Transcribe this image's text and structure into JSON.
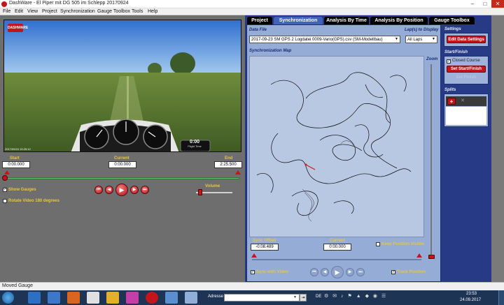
{
  "window": {
    "title": "DashWare - El Piper mit DG 505 im Schlepp 20170924",
    "min": "–",
    "max": "□",
    "close": "✕"
  },
  "menu": [
    "File",
    "Edit",
    "View",
    "Project",
    "Synchronization",
    "Gauge Toolbox",
    "Tools",
    "Help"
  ],
  "video": {
    "logo": "DASHWARE",
    "flight_time_value": "0:00",
    "flight_time_label": "Flight Time",
    "timestamp": "2017/09/24 15:25:12"
  },
  "timeline": {
    "start_label": "Start",
    "start_value": "0:00.000",
    "current_label": "Current",
    "current_value": "0:00.000",
    "end_label": "End",
    "end_value": "2:25.500"
  },
  "playback": {
    "show_gauges_label": "Show Gauges",
    "show_gauges_checked": true,
    "rotate_label": "Rotate Video 180 degrees",
    "rotate_checked": false,
    "volume_label": "Volume",
    "volume_level": 0.12
  },
  "tabs": [
    "Project",
    "Synchronization",
    "Analysis By Time",
    "Analysis By Position",
    "Gauge Toolbox"
  ],
  "active_tab": 1,
  "sync": {
    "data_file_label": "Data File",
    "data_file_value": "2017-09-23 SM GPS 2 Logdatei 0009-Vario(GPS).csv (SM-Modellbau)",
    "laps_label": "Lap(s) to Display",
    "laps_value": "All Laps",
    "map_label": "Synchronization Map",
    "zoom_label": "Zoom",
    "sync_offset_label": "Sync Offset",
    "sync_offset_value": "-0:08.489",
    "current_label": "Current",
    "current_value": "0:00.000",
    "keep_position_label": "Keep Position Visible",
    "sync_video_label": "Sync with Video",
    "track_position_label": "Track Position"
  },
  "side": {
    "settings_label": "Settings",
    "edit_data_settings": "Edit Data Settings",
    "startfinish_label": "Start/Finish",
    "closed_course_label": "Closed Course",
    "set_start_finish": "Set Start/Finish",
    "set_finish": "Set Finish",
    "splits_label": "Splits",
    "add_split": "+",
    "remove_split": "✕"
  },
  "status": {
    "text": "Moved Gauge"
  },
  "taskbar": {
    "address_label": "Adresse",
    "lang": "DE",
    "time": "23:53",
    "date": "24.09.2017"
  },
  "colors": {
    "accent_red": "#c3161c",
    "panel_blue": "#273a86",
    "label_yellow": "#e8c73a"
  }
}
